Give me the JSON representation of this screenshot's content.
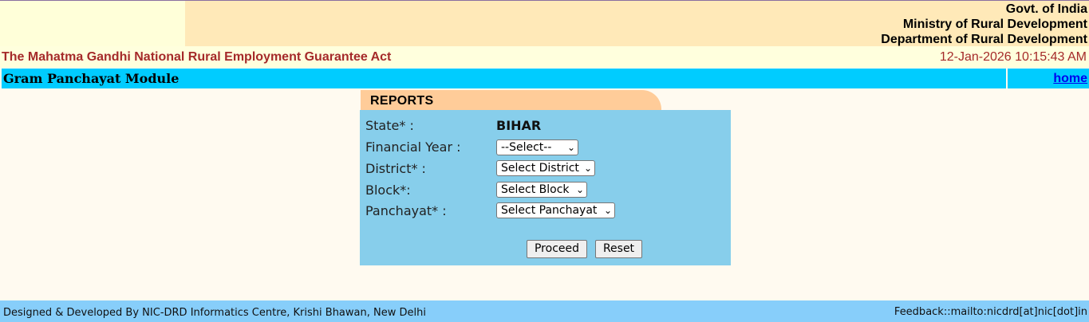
{
  "header": {
    "gov_line1": "Govt. of India",
    "gov_line2": "Ministry of Rural Development",
    "gov_line3": "Department of Rural Development",
    "act_title": "The Mahatma Gandhi National Rural Employment Guarantee Act",
    "datetime": "12-Jan-2026 10:15:43 AM"
  },
  "module": {
    "title": "Gram Panchayat Module",
    "home_link": "home"
  },
  "reports": {
    "tab_label": "REPORTS",
    "state_label": "State* :",
    "state_value": "BIHAR",
    "financial_year_label": "Financial Year :",
    "financial_year_selected": "--Select--",
    "district_label": "District* :",
    "district_selected": "Select District",
    "block_label": "Block*:",
    "block_selected": "Select Block",
    "panchayat_label": "Panchayat* :",
    "panchayat_selected": "Select Panchayat",
    "proceed_label": "Proceed",
    "reset_label": "Reset"
  },
  "footer": {
    "left_text": "Designed & Developed By NIC-DRD Informatics Centre, Krishi Bhawan, New Delhi",
    "right_text": "Feedback::mailto:nicdrd[at]nic[dot]in"
  },
  "colors": {
    "header_left": "#ffffd9",
    "header_right": "#ffe9b8",
    "act_text": "#a52a2a",
    "module_bar": "#00ccff",
    "reports_tab": "#ffcc99",
    "form_panel": "#87ceeb",
    "footer": "#87cefa"
  },
  "icons": {
    "select_arrow": "chevron-down-icon"
  }
}
